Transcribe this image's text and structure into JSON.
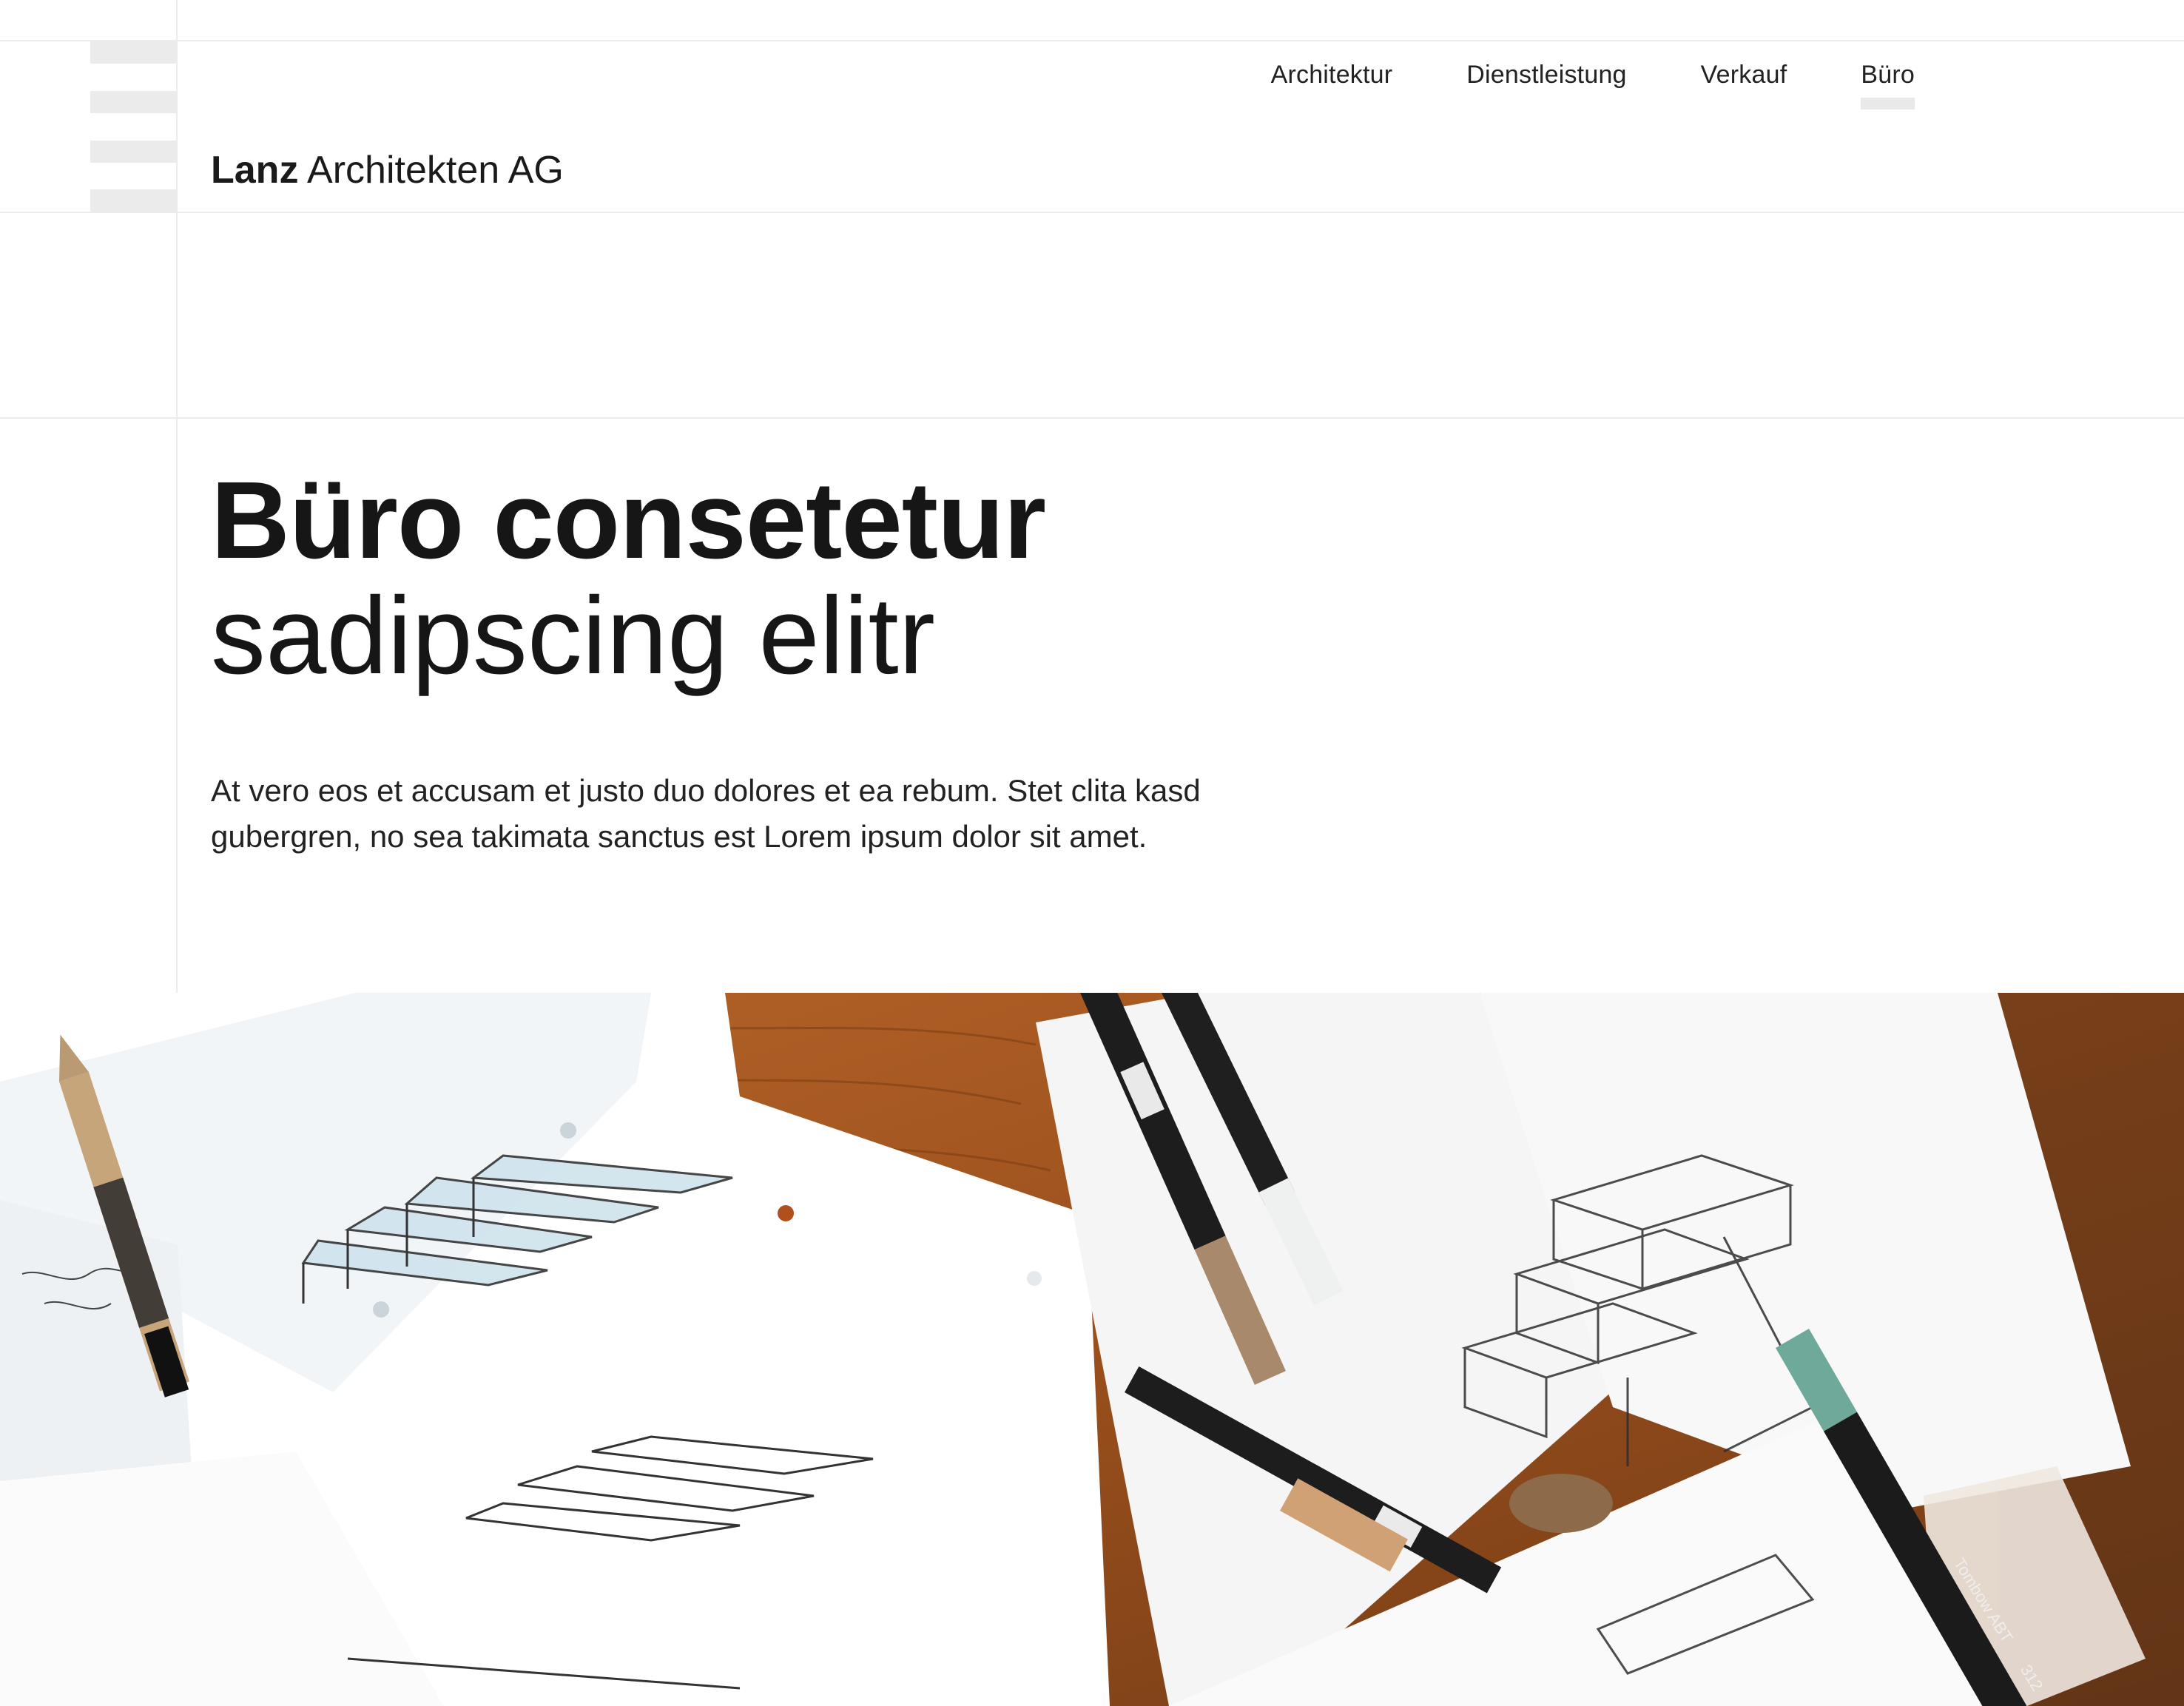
{
  "header": {
    "brand_strong": "Lanz",
    "brand_rest": "Architekten AG"
  },
  "nav": {
    "items": [
      {
        "label": "Architektur",
        "active": false
      },
      {
        "label": "Dienstleistung",
        "active": false
      },
      {
        "label": "Verkauf",
        "active": false
      },
      {
        "label": "Büro",
        "active": true
      }
    ]
  },
  "hero": {
    "title_bold": "Büro consetetur",
    "title_light": "sadipscing elitr",
    "lead": "At vero eos et accusam et justo duo dolores et ea rebum. Stet clita kasd gubergren, no sea takimata sanctus est Lorem ipsum dolor sit amet."
  },
  "photo": {
    "pen_label_1": "Tombow ABT",
    "pen_label_2": "312"
  },
  "colors": {
    "grid_line": "#ececec",
    "logo_bar": "#ebebeb",
    "wood": "#a0521c",
    "text": "#1a1a1a"
  }
}
